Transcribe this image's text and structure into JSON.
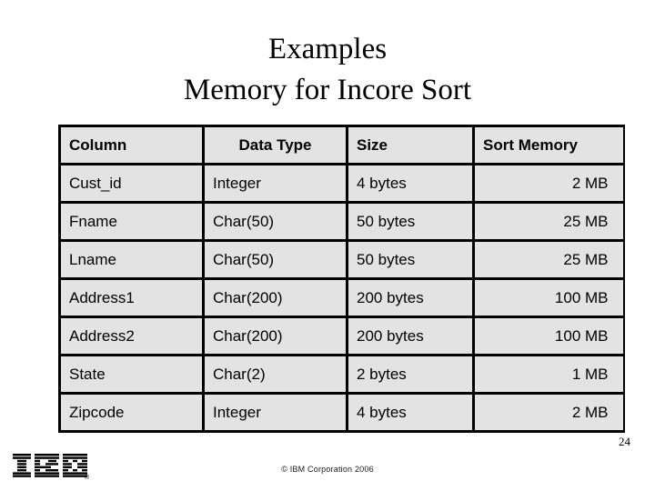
{
  "slide": {
    "title_line1": "Examples",
    "title_line2": "Memory for Incore Sort",
    "page_number": "24",
    "copyright": "© IBM Corporation 2006",
    "logo_text": "IBM",
    "logo_registered_mark": "®",
    "colors": {
      "background": "#ffffff",
      "table_cell_fill": "#e3e3e3",
      "table_border": "#000000",
      "text": "#000000"
    }
  },
  "table": {
    "headers": [
      "Column",
      "Data Type",
      "Size",
      "Sort Memory"
    ],
    "header_alignments": [
      "left",
      "center",
      "left",
      "left"
    ],
    "column_alignments": [
      "left",
      "left",
      "left",
      "right"
    ],
    "rows": [
      {
        "column": "Cust_id",
        "data_type": "Integer",
        "size": "4 bytes",
        "sort_memory": "2 MB"
      },
      {
        "column": "Fname",
        "data_type": "Char(50)",
        "size": "50 bytes",
        "sort_memory": "25 MB"
      },
      {
        "column": "Lname",
        "data_type": "Char(50)",
        "size": "50 bytes",
        "sort_memory": "25 MB"
      },
      {
        "column": "Address1",
        "data_type": "Char(200)",
        "size": "200 bytes",
        "sort_memory": "100 MB"
      },
      {
        "column": "Address2",
        "data_type": "Char(200)",
        "size": "200 bytes",
        "sort_memory": "100 MB"
      },
      {
        "column": "State",
        "data_type": "Char(2)",
        "size": "2 bytes",
        "sort_memory": "1 MB"
      },
      {
        "column": "Zipcode",
        "data_type": "Integer",
        "size": "4 bytes",
        "sort_memory": "2 MB"
      }
    ]
  }
}
